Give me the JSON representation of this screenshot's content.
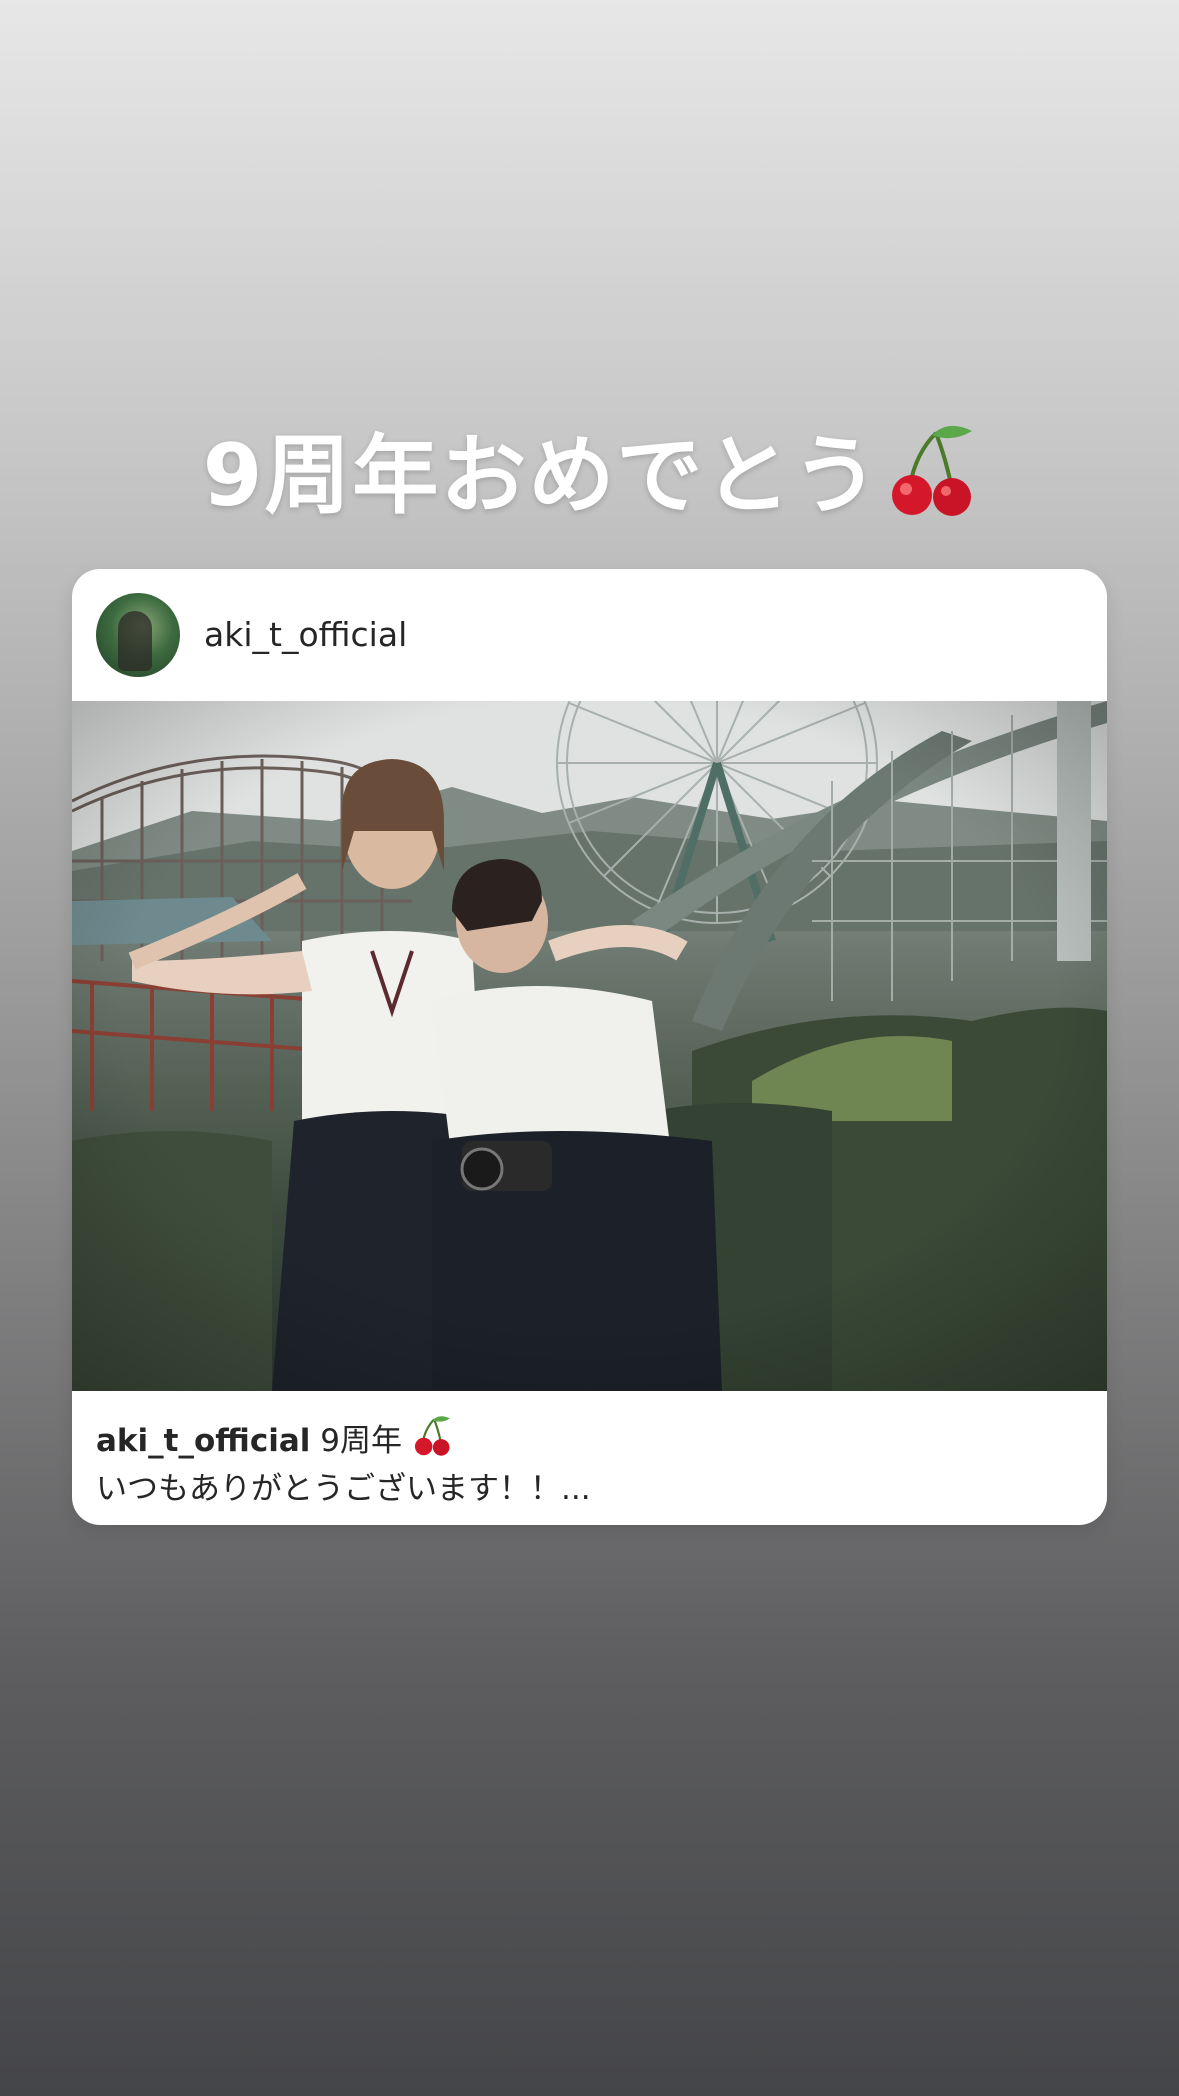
{
  "story": {
    "caption_text": "9周年おめでとう",
    "caption_emoji": "cherry-emoji"
  },
  "post": {
    "username": "aki_t_official",
    "caption": {
      "username": "aki_t_official",
      "line1": "9周年",
      "line1_emoji": "cherry-emoji",
      "line2": "いつもありがとうございます！！..."
    },
    "photo": "two-students-in-uniforms-at-amusement-park"
  },
  "colors": {
    "background_top": "#e7e7e7",
    "background_bottom": "#444548",
    "card": "#ffffff",
    "text": "#262626",
    "cherry": "#d4182a",
    "cherry_leaf": "#5aa84a"
  }
}
